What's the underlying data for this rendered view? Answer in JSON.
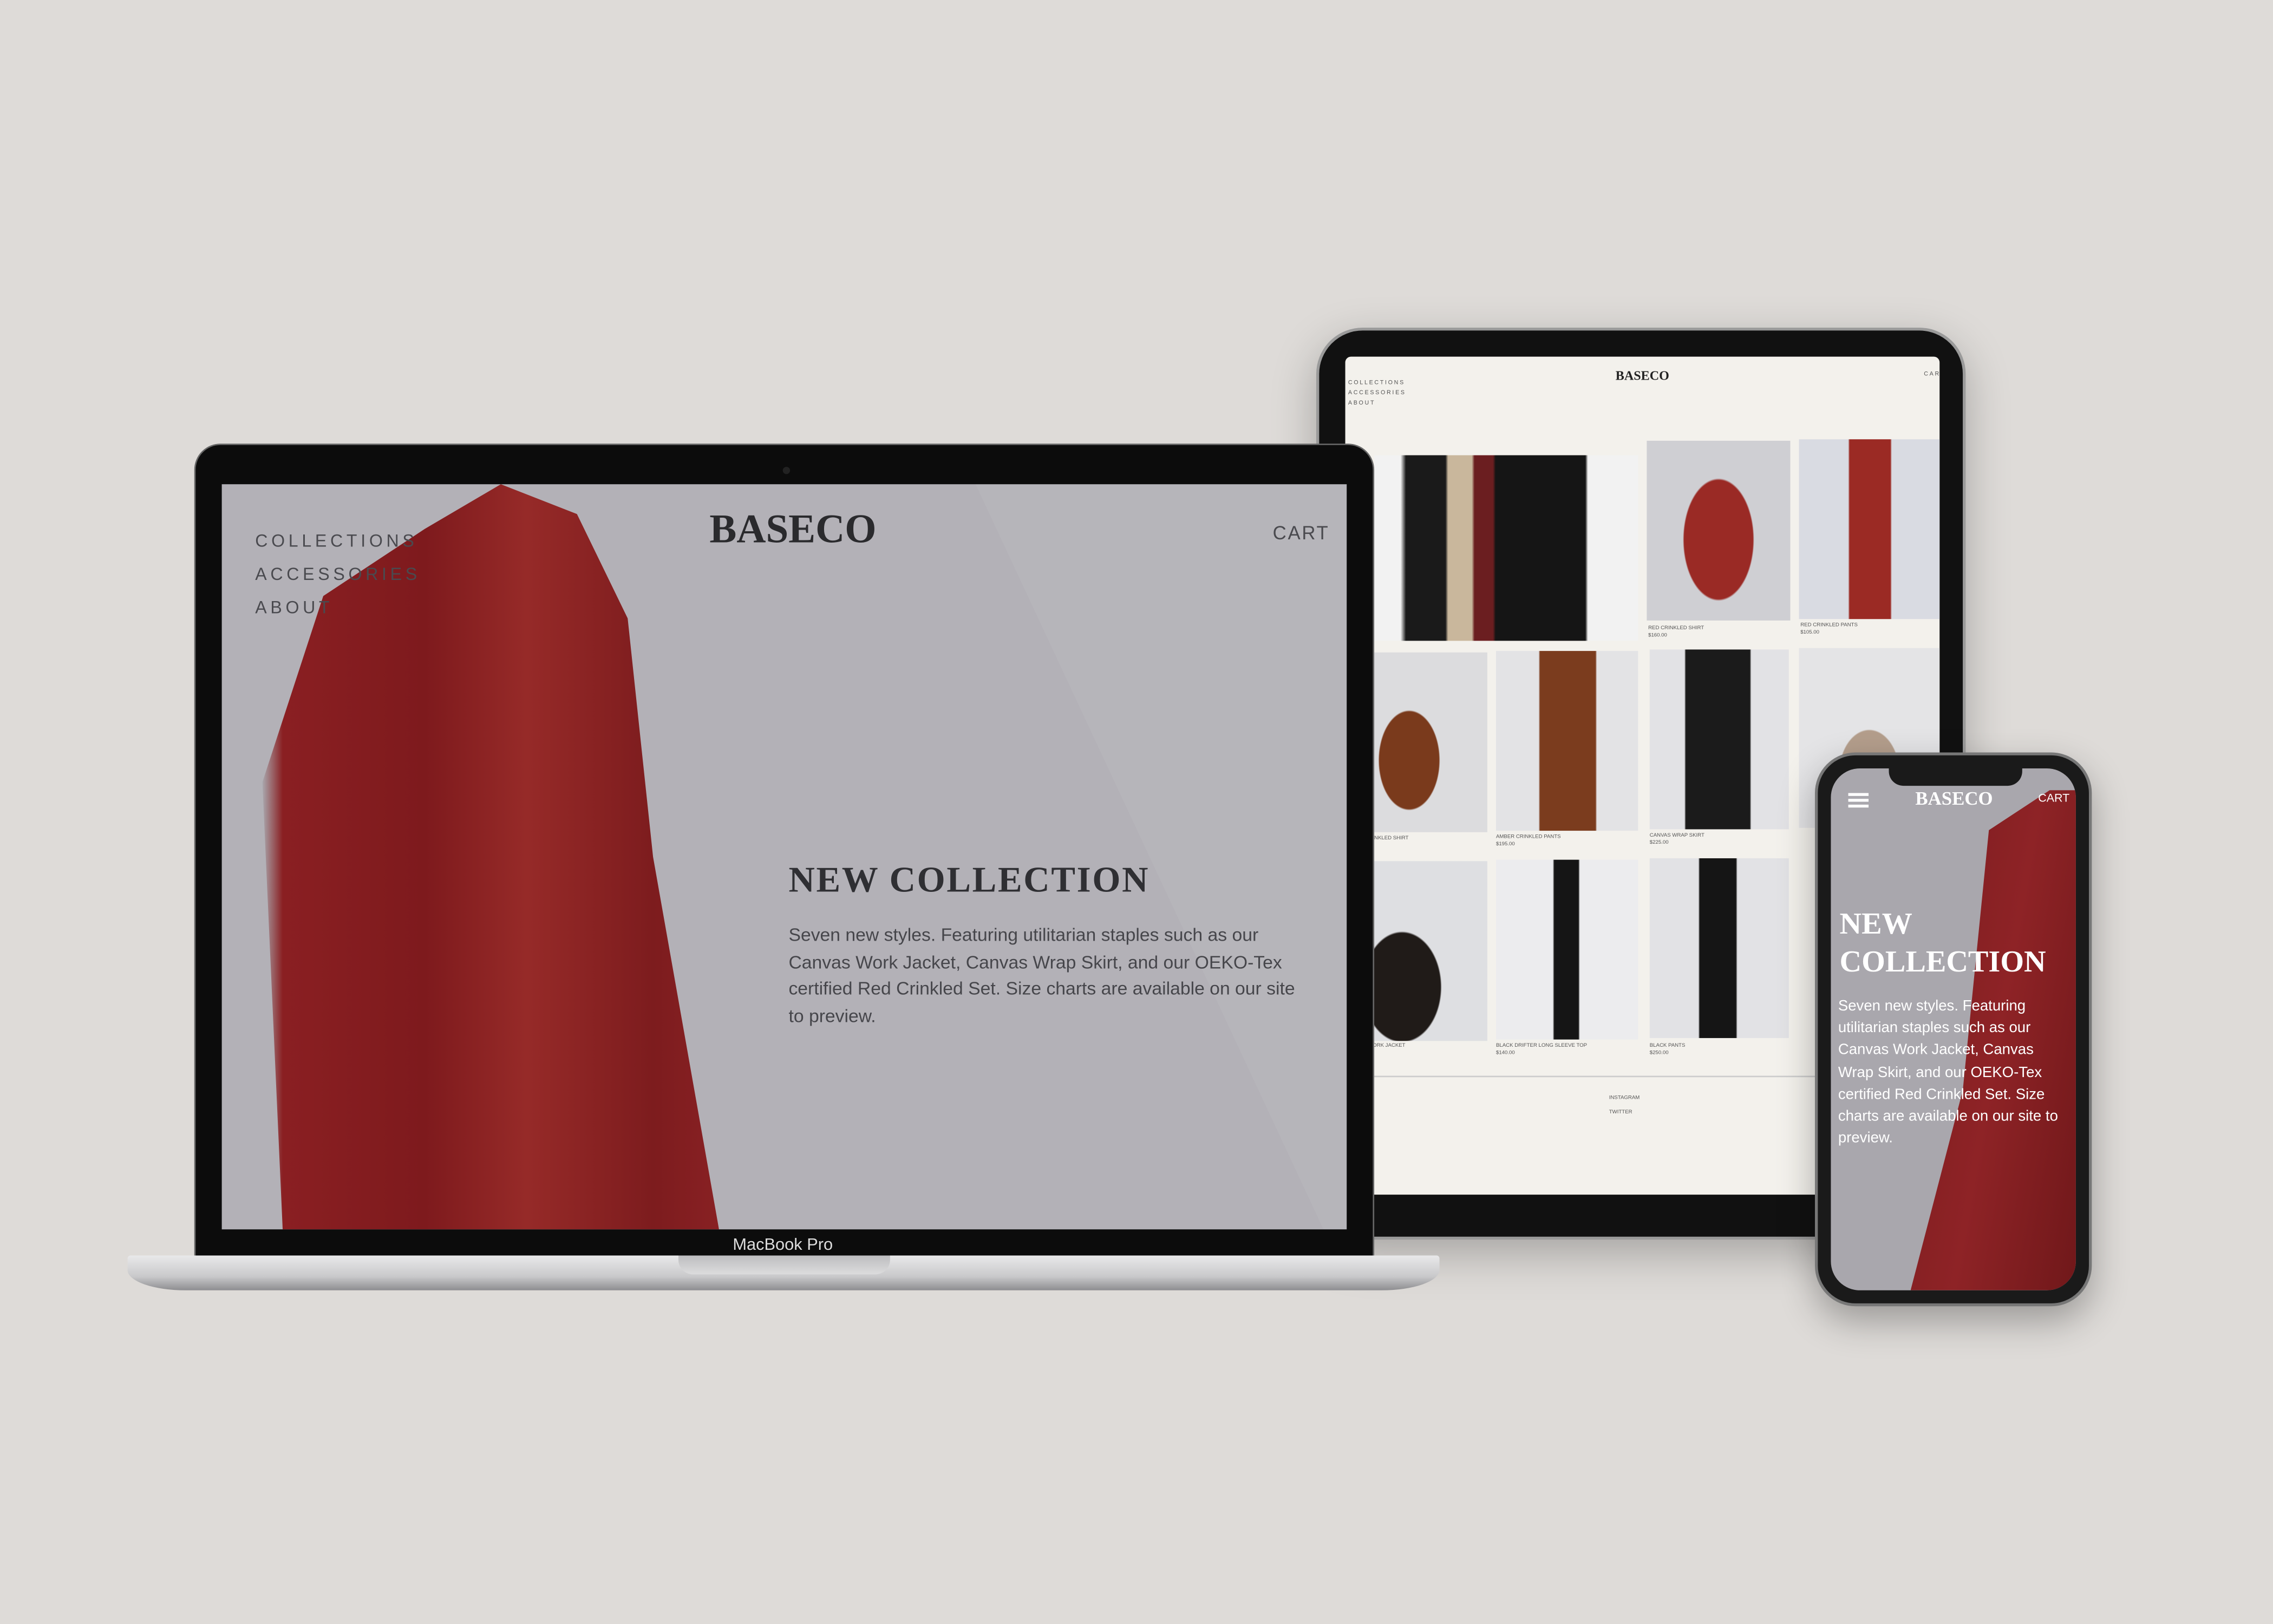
{
  "brand": "BASECO",
  "laptop": {
    "device_label": "MacBook Pro",
    "nav": [
      "COLLECTIONS",
      "ACCESSORIES",
      "ABOUT"
    ],
    "cart": "CART",
    "hero_title": "NEW COLLECTION",
    "hero_text": "Seven new styles. Featuring utilitarian staples such as our Canvas Work Jacket, Canvas Wrap Skirt, and our OEKO-Tex certified Red Crinkled Set. Size charts are available on our site to preview."
  },
  "tablet": {
    "nav": [
      "COLLECTIONS",
      "ACCESSORIES",
      "ABOUT"
    ],
    "cart": "CART",
    "products": [
      {
        "name": "RED CRINKLED SHIRT",
        "price": "$160.00"
      },
      {
        "name": "RED CRINKLED PANTS",
        "price": "$105.00"
      },
      {
        "name": "AMBER CRINKLED SHIRT",
        "price": ""
      },
      {
        "name": "AMBER CRINKLED PANTS",
        "price": "$195.00"
      },
      {
        "name": "CANVAS WRAP SKIRT",
        "price": "$225.00"
      },
      {
        "name": "CANVAS WORK JACKET",
        "price": ""
      },
      {
        "name": "BLACK DRIFTER LONG SLEEVE TOP",
        "price": "$140.00"
      },
      {
        "name": "BLACK PANTS",
        "price": "$250.00"
      }
    ],
    "footer": [
      "INSTAGRAM",
      "TWITTER"
    ]
  },
  "phone": {
    "cart": "CART",
    "hero_title_line1": "NEW",
    "hero_title_line2": "COLLECTION",
    "hero_text": "Seven new styles. Featuring utilitarian staples such as our Canvas Work Jacket, Canvas Wrap Skirt, and our OEKO-Tex certified Red Crinkled Set. Size charts are available on our site to preview."
  },
  "colors": {
    "background": "#dedbd8",
    "accent_red": "#8a1f22",
    "hero_gray": "#b3b1b7",
    "tablet_bg": "#f3f1ec"
  }
}
